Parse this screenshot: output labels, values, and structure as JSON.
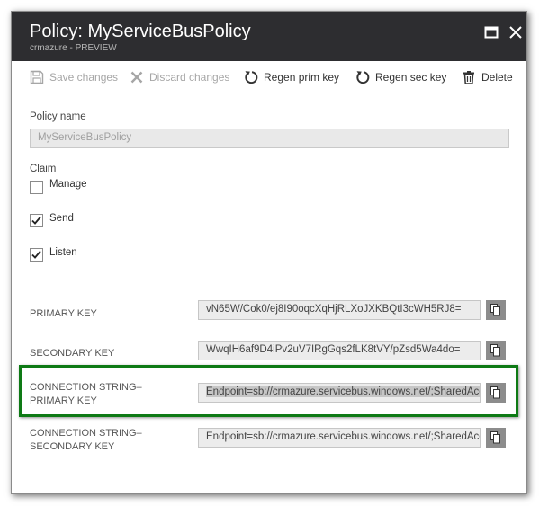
{
  "window": {
    "title": "Policy: MyServiceBusPolicy",
    "subtitle_prefix": "crmazure",
    "subtitle_separator": " - ",
    "subtitle_suffix": "Preview"
  },
  "toolbar": {
    "save_label": "Save changes",
    "discard_label": "Discard changes",
    "regen_primary_label": "Regen prim key",
    "regen_secondary_label": "Regen sec key",
    "delete_label": "Delete"
  },
  "form": {
    "policy_name_label": "Policy name",
    "policy_name_value": "MyServiceBusPolicy",
    "claim_label": "Claim",
    "claims": [
      {
        "label": "Manage",
        "checked": false
      },
      {
        "label": "Send",
        "checked": true
      },
      {
        "label": "Listen",
        "checked": true
      }
    ]
  },
  "keys": {
    "primary_key_label": "Primary key",
    "primary_key_value": "vN65W/Cok0/ej8I90oqcXqHjRLXoJXKBQtI3cWH5RJ8=",
    "secondary_key_label": "Secondary key",
    "secondary_key_value": "WwqIH6af9D4iPv2uV7IRgGqs2fLK8tVY/pZsd5Wa4do=",
    "conn_primary_label_line1": "Connection string–",
    "conn_primary_label_line2": "primary key",
    "conn_primary_value": "Endpoint=sb://crmazure.servicebus.windows.net/;SharedAccessKeyName=MyServiceBusPolicy",
    "conn_secondary_label_line1": "Connection string–",
    "conn_secondary_label_line2": "secondary key",
    "conn_secondary_value": "Endpoint=sb://crmazure.servicebus.windows.net/;SharedAccessKeyName=MyServiceBusPolicy"
  },
  "colors": {
    "title_bar": "#2d2d30",
    "highlight_border": "#0e7a15",
    "copy_button": "#8c8c8c"
  },
  "icons": {
    "maximize": "maximize-icon",
    "close": "close-icon",
    "save": "save-icon",
    "discard": "discard-icon",
    "regen": "refresh-icon",
    "delete": "trash-icon",
    "copy": "copy-icon",
    "checkmark": "checkmark-icon"
  }
}
